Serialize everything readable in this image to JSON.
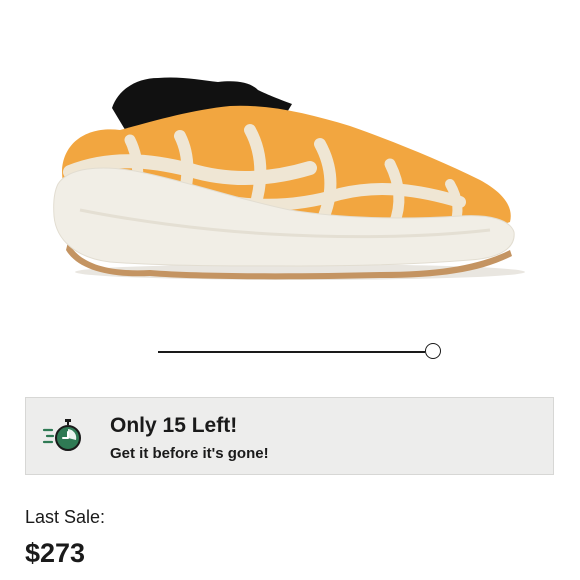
{
  "product": {
    "image_alt": "sneaker-product-image",
    "colors": {
      "upper_orange": "#f2a640",
      "cage_cream": "#efe6d4",
      "midsole_white": "#f1eee6",
      "outsole_gum": "#c49462",
      "collar_black": "#111111"
    }
  },
  "viewer": {
    "slider_position_fraction": 1.0
  },
  "stock_banner": {
    "icon": "stopwatch-icon",
    "title": "Only 15 Left!",
    "subtitle": "Get it before it's gone!",
    "accent_color": "#2f7a54"
  },
  "last_sale": {
    "label": "Last Sale:",
    "price": "$273"
  }
}
